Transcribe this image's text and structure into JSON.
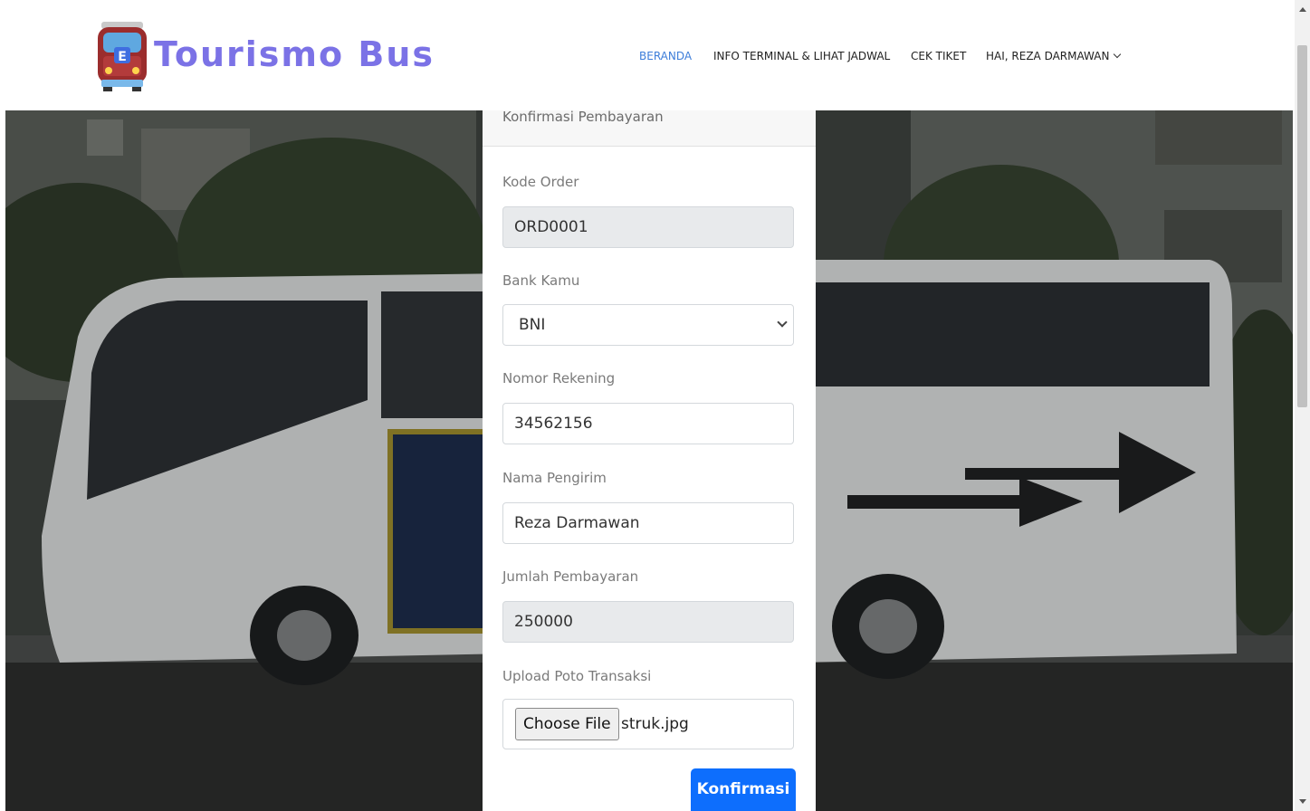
{
  "brand": {
    "name": "Tourismo Bus",
    "logo_icon": "bus-logo-icon",
    "accent": "#7b72e6"
  },
  "nav": {
    "items": [
      {
        "label": "BERANDA",
        "active": true
      },
      {
        "label": "INFO TERMINAL & LIHAT JADWAL",
        "active": false
      },
      {
        "label": "CEK TIKET",
        "active": false
      },
      {
        "label": "HAI, REZA DARMAWAN",
        "active": false,
        "icon": "chevron-down-icon"
      }
    ]
  },
  "form": {
    "title": "Konfirmasi Pembayaran",
    "fields": {
      "kode_order": {
        "label": "Kode Order",
        "value": "ORD0001"
      },
      "bank": {
        "label": "Bank Kamu",
        "value": "BNI"
      },
      "rekening": {
        "label": "Nomor Rekening",
        "value": "34562156"
      },
      "pengirim": {
        "label": "Nama Pengirim",
        "value": "Reza Darmawan"
      },
      "jumlah": {
        "label": "Jumlah Pembayaran",
        "value": "250000"
      },
      "upload": {
        "label": "Upload Poto Transaksi",
        "button": "Choose File",
        "file": "struk.jpg"
      }
    },
    "submit_label": "Konfirmasi",
    "submit_color": "#0d6efd"
  }
}
